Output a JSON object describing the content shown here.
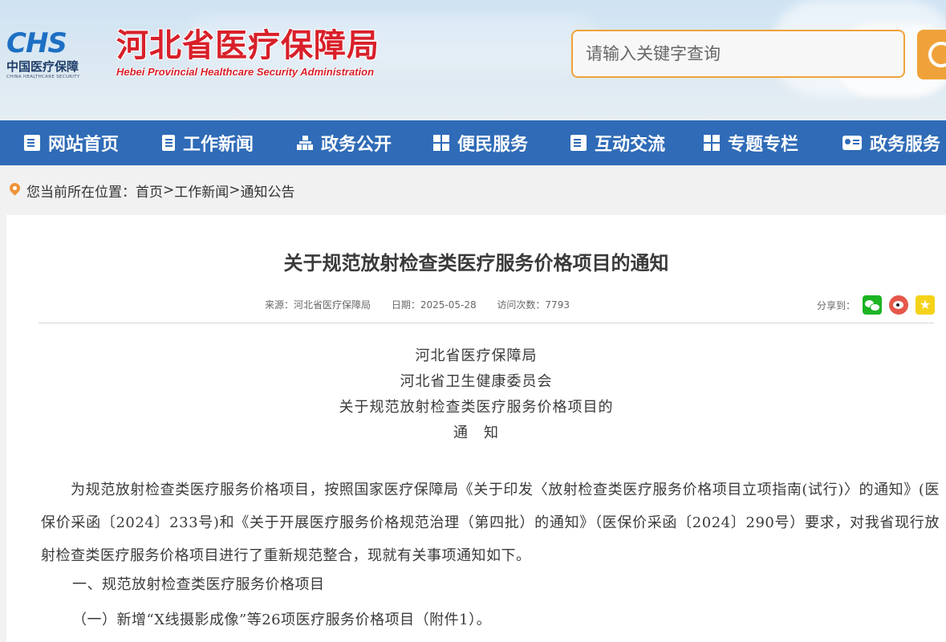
{
  "header": {
    "logo_mark": "CHS",
    "logo_cn": "中国医疗保障",
    "logo_en": "CHINA HEALTHCARE SECURITY",
    "site_title_cn": "河北省医疗保障局",
    "site_title_en": "Hebei Provincial Healthcare Security Administration",
    "search_placeholder": "请输入关键字查询",
    "search_icon": "search-icon",
    "accent_color": "#f0a23a",
    "title_color": "#d8202a"
  },
  "nav": {
    "bg_color": "#2f6bb7",
    "items": [
      {
        "label": "网站首页",
        "icon": "document-icon"
      },
      {
        "label": "工作新闻",
        "icon": "bookmark-doc-icon"
      },
      {
        "label": "政务公开",
        "icon": "org-tree-icon"
      },
      {
        "label": "便民服务",
        "icon": "grid-icon"
      },
      {
        "label": "互动交流",
        "icon": "document-icon"
      },
      {
        "label": "专题专栏",
        "icon": "grid-icon"
      },
      {
        "label": "政务服务",
        "icon": "id-card-icon"
      }
    ]
  },
  "breadcrumb": {
    "prefix": "您当前所在位置：",
    "items": [
      "首页",
      "工作新闻",
      "通知公告"
    ],
    "separator": ">"
  },
  "article": {
    "title": "关于规范放射检查类医疗服务价格项目的通知",
    "source": "来源：河北省医疗保障局",
    "date": "日期：2025-05-28",
    "views": "访问次数：7793",
    "share_label": "分享到：",
    "heading_lines": [
      "河北省医疗保障局",
      "河北省卫生健康委员会",
      "关于规范放射检查类医疗服务价格项目的",
      "通　知"
    ],
    "paragraphs": [
      "为规范放射检查类医疗服务价格项目，按照国家医疗保障局《关于印发〈放射检查类医疗服务价格项目立项指南(试行)〉的通知》(医保价采函〔2024〕233号)和《关于开展医疗服务价格规范治理（第四批）的通知》（医保价采函〔2024〕290号）要求，对我省现行放射检查类医疗服务价格项目进行了重新规范整合，现就有关事项通知如下。",
      "一、规范放射检查类医疗服务价格项目",
      "（一）新增“X线摄影成像”等26项医疗服务价格项目（附件1）。"
    ]
  }
}
